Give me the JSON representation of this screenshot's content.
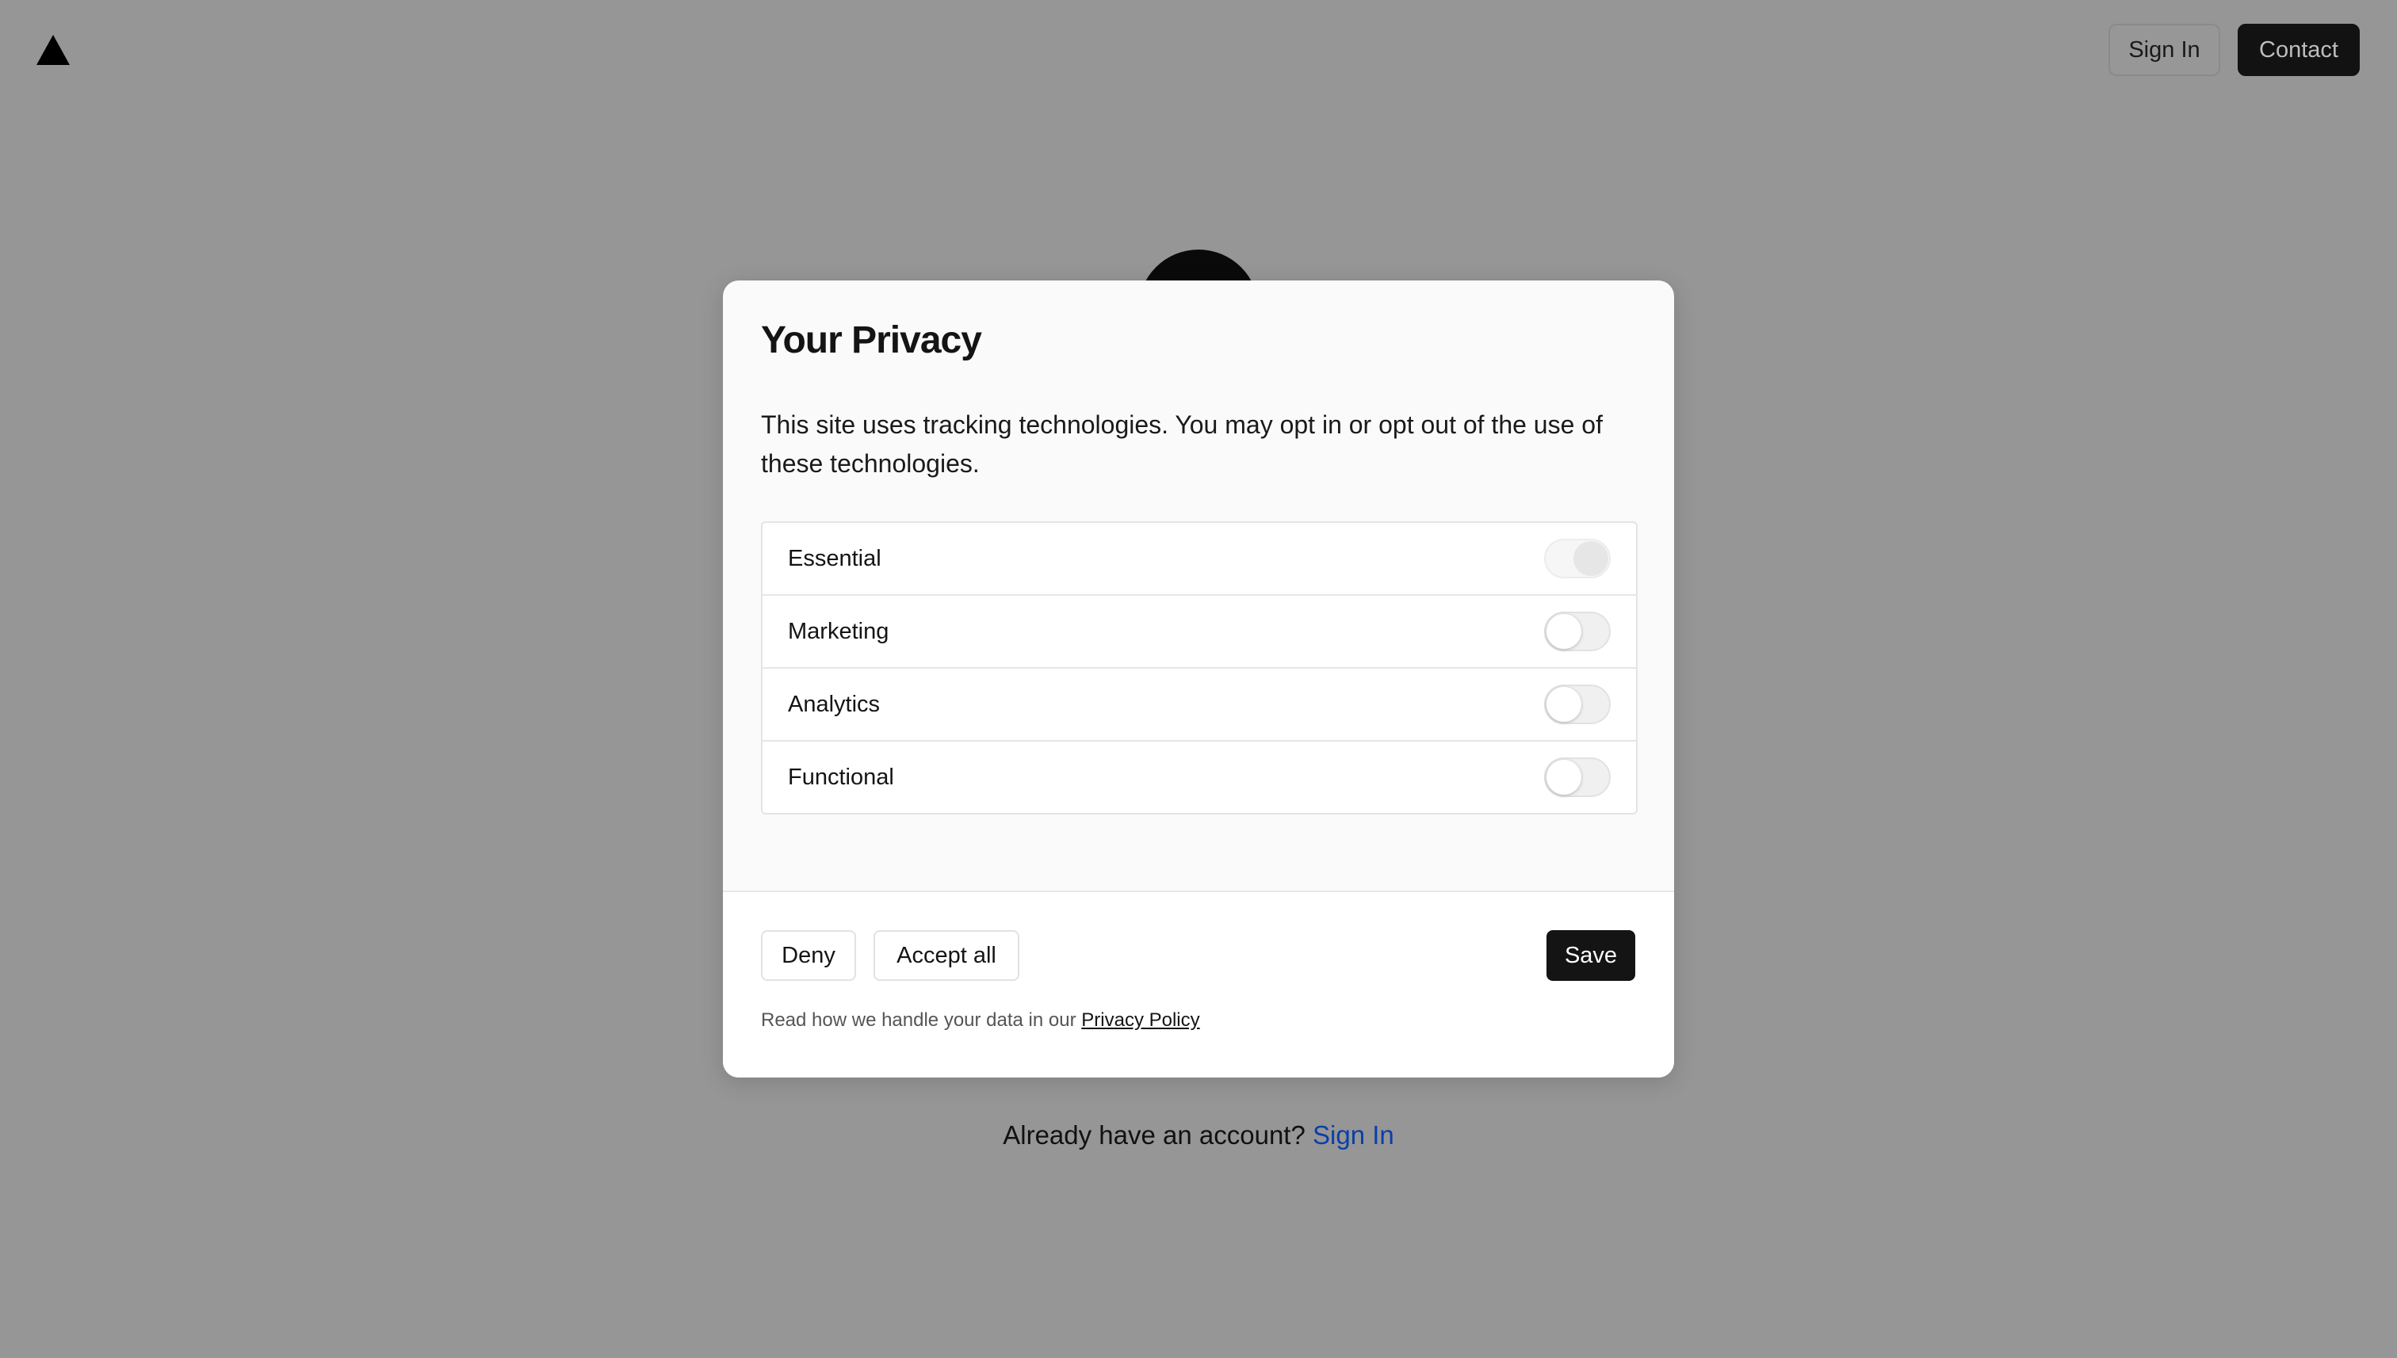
{
  "nav": {
    "logo_icon": "triangle-logo-icon",
    "sign_in_label": "Sign In",
    "contact_label": "Contact"
  },
  "page": {
    "already_text": "Already have an account?",
    "sign_in_link": "Sign In"
  },
  "privacy_modal": {
    "title": "Your Privacy",
    "description": "This site uses tracking technologies. You may opt in or opt out of the use of these technologies.",
    "categories": [
      {
        "label": "Essential",
        "enabled": true,
        "disabled": true
      },
      {
        "label": "Marketing",
        "enabled": false,
        "disabled": false
      },
      {
        "label": "Analytics",
        "enabled": false,
        "disabled": false
      },
      {
        "label": "Functional",
        "enabled": false,
        "disabled": false
      }
    ],
    "deny_label": "Deny",
    "accept_all_label": "Accept all",
    "save_label": "Save",
    "policy_text": "Read how we handle your data in our",
    "policy_link": "Privacy Policy"
  },
  "colors": {
    "overlay_background": "#969696",
    "primary_button": "#141414",
    "link_blue": "#0b3fa8"
  }
}
